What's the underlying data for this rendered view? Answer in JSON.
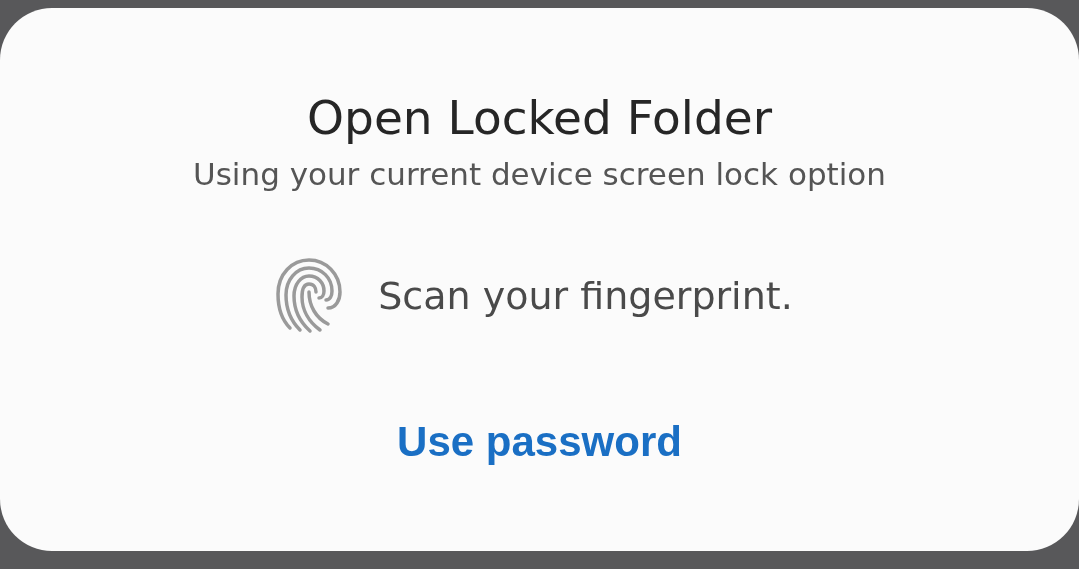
{
  "dialog": {
    "title": "Open Locked Folder",
    "subtitle": "Using your current device screen lock option",
    "prompt": "Scan your fingerprint.",
    "action": "Use password"
  }
}
